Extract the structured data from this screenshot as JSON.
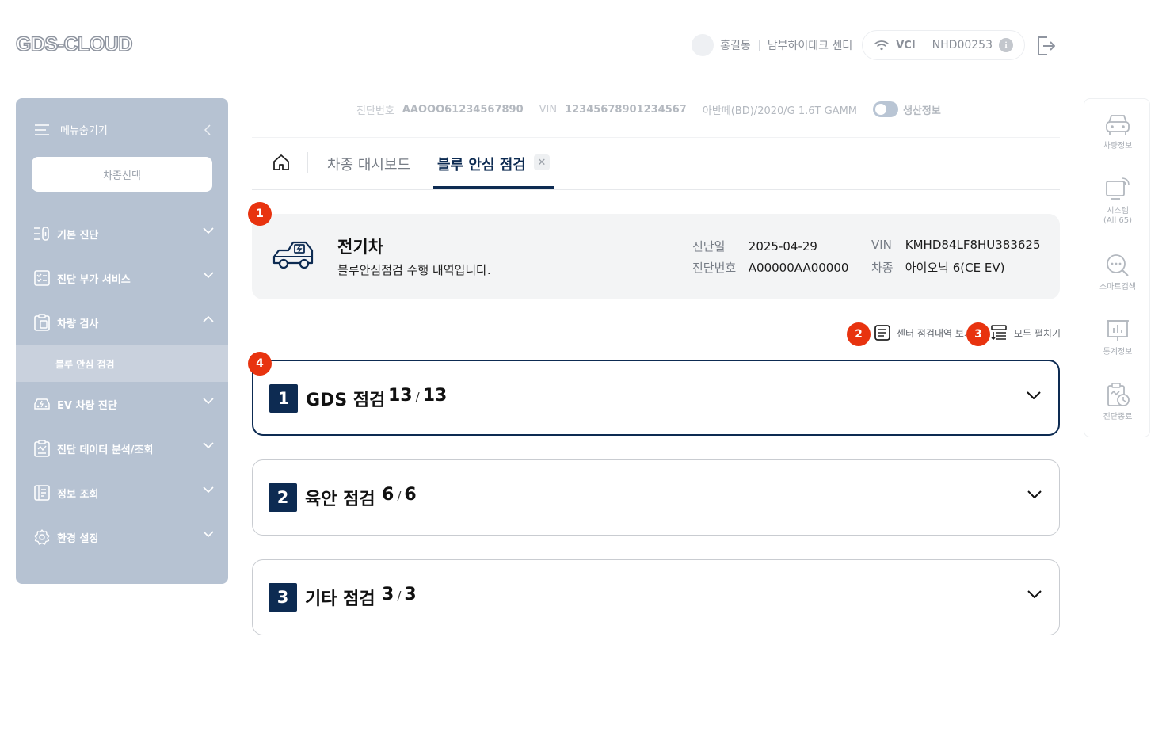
{
  "header": {
    "logo": "GDS-CLOUD",
    "user_name": "홍길동",
    "center_name": "남부하이테크 센터",
    "vci_label": "VCI",
    "vci_id": "NHD00253",
    "info_glyph": "i"
  },
  "sidebar": {
    "menu_toggle": "메뉴숨기기",
    "model_select": "차종선택",
    "items": [
      {
        "label": "기본 진단",
        "icon": "basic-diagnosis-icon"
      },
      {
        "label": "진단 부가 서비스",
        "icon": "checklist-icon"
      },
      {
        "label": "차량 검사",
        "icon": "clipboard-icon"
      },
      {
        "label": "EV 차량 진단",
        "icon": "ev-car-icon"
      },
      {
        "label": "진단 데이터 분석/조회",
        "icon": "data-analysis-icon"
      },
      {
        "label": "정보 조회",
        "icon": "info-lookup-icon"
      },
      {
        "label": "환경 설정",
        "icon": "gear-icon"
      }
    ],
    "sub_item": "블루 안심 점검"
  },
  "infobar": {
    "diag_label": "진단번호",
    "diag_value": "AAOOO61234567890",
    "vin_label": "VIN",
    "vin_value": "12345678901234567",
    "model": "아반떼(BD)/2020/G 1.6T GAMM",
    "toggle_label": "생산정보"
  },
  "tabs": {
    "items": [
      "차종 대시보드",
      "블루 안심 점검"
    ],
    "close_glyph": "✕"
  },
  "summary": {
    "title": "전기차",
    "desc": "블루안심점검 수행 내역입니다.",
    "diag_date_label": "진단일",
    "diag_date": "2025-04-29",
    "diag_no_label": "진단번호",
    "diag_no": "A00000AA00000",
    "vin_label": "VIN",
    "vin": "KMHD84LF8HU383625",
    "model_label": "차종",
    "model": "아이오닉 6(CE EV)"
  },
  "badges": [
    "1",
    "2",
    "3",
    "4"
  ],
  "actions": {
    "center_history": "센터 점검내역 보기",
    "expand_all": "모두 펼치기"
  },
  "sections": [
    {
      "num": "1",
      "title": "GDS 점검",
      "done": "13",
      "total": "13"
    },
    {
      "num": "2",
      "title": "육안 점검",
      "done": "6",
      "total": "6"
    },
    {
      "num": "3",
      "title": "기타 점검",
      "done": "3",
      "total": "3"
    }
  ],
  "rail": {
    "vehicle_info": "차량정보",
    "system": "시스템",
    "system_count": "(All 65)",
    "smart_search": "스마트검색",
    "statistics": "통계정보",
    "end_diagnosis": "진단종료"
  },
  "colors": {
    "primary": "#0d2b52",
    "badge": "#e8330f",
    "sidebar": "#b6c2d2"
  }
}
